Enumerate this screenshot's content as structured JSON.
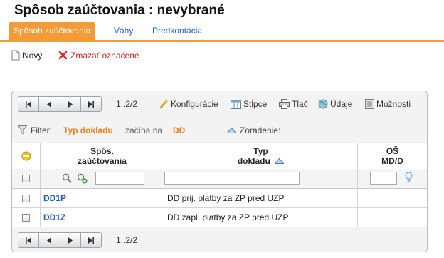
{
  "page": {
    "title": "Spôsob zaúčtovania :  nevybrané"
  },
  "tabs": [
    {
      "label": "Spôsob zaúčtovania",
      "active": true
    },
    {
      "label": "Váhy",
      "active": false
    },
    {
      "label": "Predkontácia",
      "active": false
    }
  ],
  "actions": {
    "new_label": "Nový",
    "delete_label": "Zmazať označené"
  },
  "pager": {
    "info": "1..2/2",
    "bottom_info": "1..2/2"
  },
  "toolbar": {
    "config": "Konfigurácie",
    "columns": "Stĺpce",
    "print": "Tlač",
    "data": "Údaje",
    "options": "Možnosti"
  },
  "filter": {
    "label": "Filter:",
    "field": "Typ dokladu",
    "operator": "začína na",
    "value": "DD",
    "sort_label": "Zoradenie:"
  },
  "columns": {
    "code_line1": "Spôs.",
    "code_line2": "zaúčtovania",
    "type_line1": "Typ",
    "type_line2": "dokladu",
    "md_line1": "OŠ",
    "md_line2": "MD/D"
  },
  "rows": [
    {
      "code": "DD1P",
      "type": "DD prij. platby za ZP pred UZP",
      "md": ""
    },
    {
      "code": "DD1Z",
      "type": "DD zapl. platby za ZP pred UZP",
      "md": ""
    }
  ],
  "colors": {
    "accent": "#f29b38",
    "link": "#1f5fb4",
    "delete": "#cc2222"
  }
}
